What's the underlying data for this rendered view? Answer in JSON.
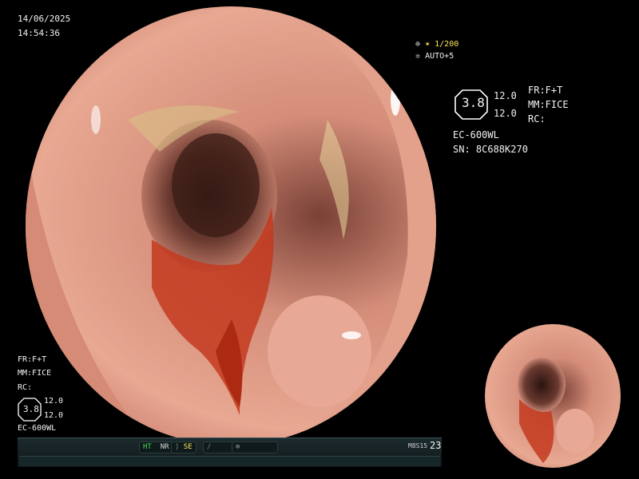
{
  "timestamp": {
    "date": "14/06/2025",
    "time": "14:54:36"
  },
  "top_right_settings": {
    "shutter": "✶ 1/200",
    "auto": "AUTO+5"
  },
  "main_panel": {
    "scale_value": "3.8",
    "value_a": "12.0",
    "value_b": "12.0",
    "fr": "FR:F+T",
    "mm": "MM:FICE",
    "rc": "RC:",
    "scope_model": "EC-600WL",
    "serial": "SN: 8C688K270"
  },
  "bottom_left_panel": {
    "fr": "FR:F+T",
    "mm": "MM:FICE",
    "rc": "RC:",
    "scale_value": "3.8",
    "value_a": "12.0",
    "value_b": "12.0",
    "scope_model": "EC-600WL"
  },
  "toolbar": {
    "ht_label": "HT",
    "nr_label": "NR",
    "se_label": "SE",
    "right_code": "M8S15",
    "counter": "23"
  },
  "colors": {
    "green": "#3ddc52",
    "yellow": "#ffe75a"
  }
}
